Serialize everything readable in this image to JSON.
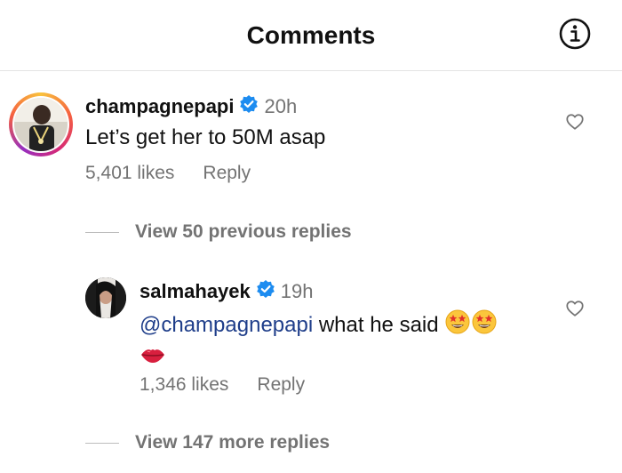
{
  "header": {
    "title": "Comments",
    "info_icon": "info-icon"
  },
  "comments": [
    {
      "username": "champagnepapi",
      "verified": true,
      "time": "20h",
      "text": "Let’s get her to 50M asap",
      "likes": "5,401 likes",
      "reply_label": "Reply"
    }
  ],
  "thread": {
    "view_previous": "View 50 previous replies",
    "reply": {
      "username": "salmahayek",
      "verified": true,
      "time": "19h",
      "mention": "@champagnepapi",
      "text": " what he said",
      "emojis": [
        "star-struck-emoji",
        "star-struck-emoji",
        "lips-emoji"
      ],
      "likes": "1,346 likes",
      "reply_label": "Reply"
    },
    "view_more": "View 147 more replies"
  },
  "colors": {
    "link": "#1f3e8a",
    "muted": "#737373",
    "verified": "#1d8cf0"
  }
}
